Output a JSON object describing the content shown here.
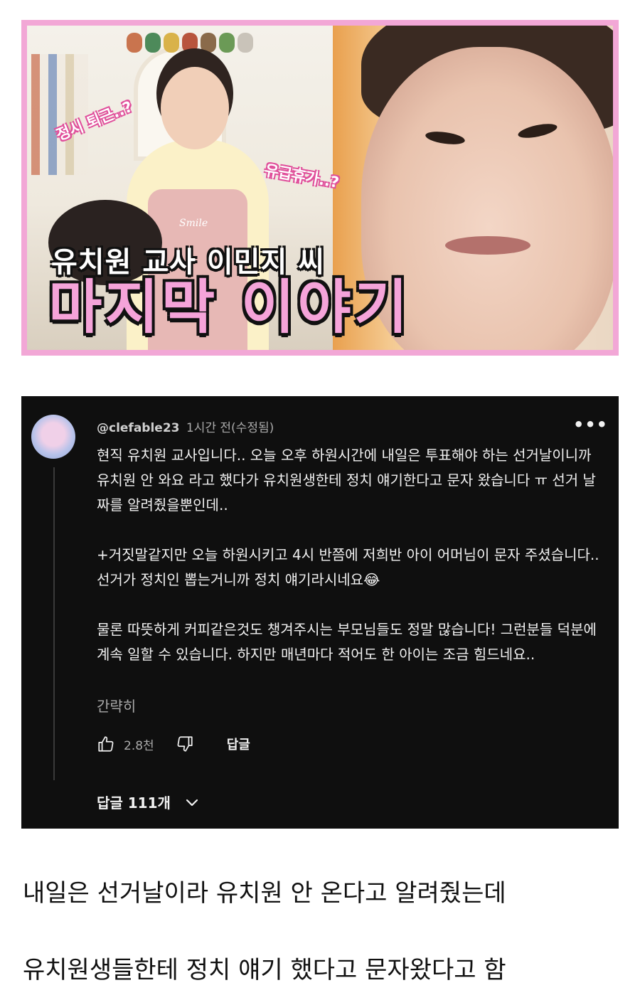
{
  "thumbnail": {
    "bubble_left": "정시 퇴근..?",
    "bubble_right": "유급휴가..?",
    "apron_text": "Smile",
    "title_line1": "유치원 교사 이민지 씨",
    "title_line2": "마지막 이야기",
    "colors": {
      "frame": "#f2a7d6",
      "title_pink": "#f5a3d9"
    }
  },
  "comment": {
    "handle": "@clefable23",
    "time": "1시간 전(수정됨)",
    "paragraphs": [
      "현직 유치원 교사입니다.. 오늘 오후 하원시간에 내일은 투표해야 하는 선거날이니까 유치원 안 와요 라고 했다가 유치원생한테 정치 얘기한다고 문자 왔습니다 ㅠ 선거 날짜를 알려줬을뿐인데..",
      "+거짓말같지만 오늘 하원시키고 4시 반쯤에 저희반 아이 어머님이 문자 주셨습니다.. 선거가 정치인 뽑는거니까 정치 얘기라시네요😂",
      "물론 따뜻하게 커피같은것도 챙겨주시는 부모님들도 정말 많습니다! 그런분들 덕분에 계속 일할 수 있습니다. 하지만 매년마다 적어도 한 아이는 조금 힘드네요.."
    ],
    "show_less": "간략히",
    "like_count": "2.8천",
    "reply_label": "답글",
    "replies_label": "답글 111개",
    "icons": {
      "more": "more-vertical-icon",
      "like": "thumbs-up-icon",
      "dislike": "thumbs-down-icon",
      "expand": "chevron-down-icon"
    }
  },
  "caption": {
    "line1": "내일은 선거날이라 유치원 안 온다고 알려줬는데",
    "line2": "유치원생들한테 정치 얘기 했다고 문자왔다고 함"
  }
}
